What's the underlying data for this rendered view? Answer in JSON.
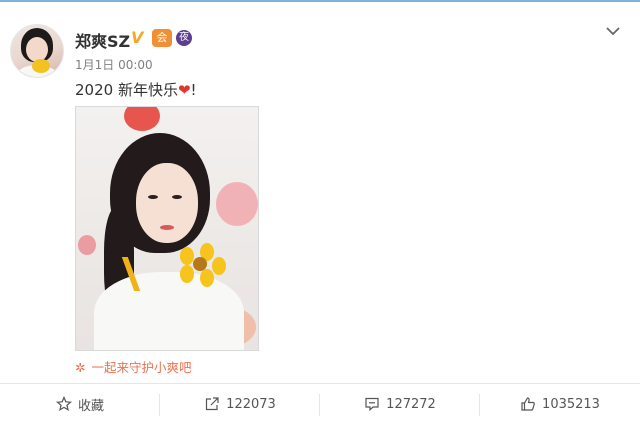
{
  "post": {
    "username": "郑爽SZ",
    "verified_badge": "V",
    "member_badge": "会",
    "vip_badge": "夜",
    "time": "1月1日 00:00",
    "text": "2020 新年快乐",
    "emoji": "❤",
    "text_suffix": "!",
    "tagline": "一起来守护小爽吧",
    "tagline_icon": "✲"
  },
  "actions": {
    "favorite_label": "收藏",
    "repost_count": "122073",
    "comment_count": "127272",
    "like_count": "1035213"
  },
  "colors": {
    "link_orange": "#eb7350",
    "verified_gold": "#f5a623",
    "heart_red": "#e0362f"
  },
  "icons": [
    "chevron-down-icon",
    "star-icon",
    "share-icon",
    "comment-icon",
    "thumbs-up-icon"
  ]
}
